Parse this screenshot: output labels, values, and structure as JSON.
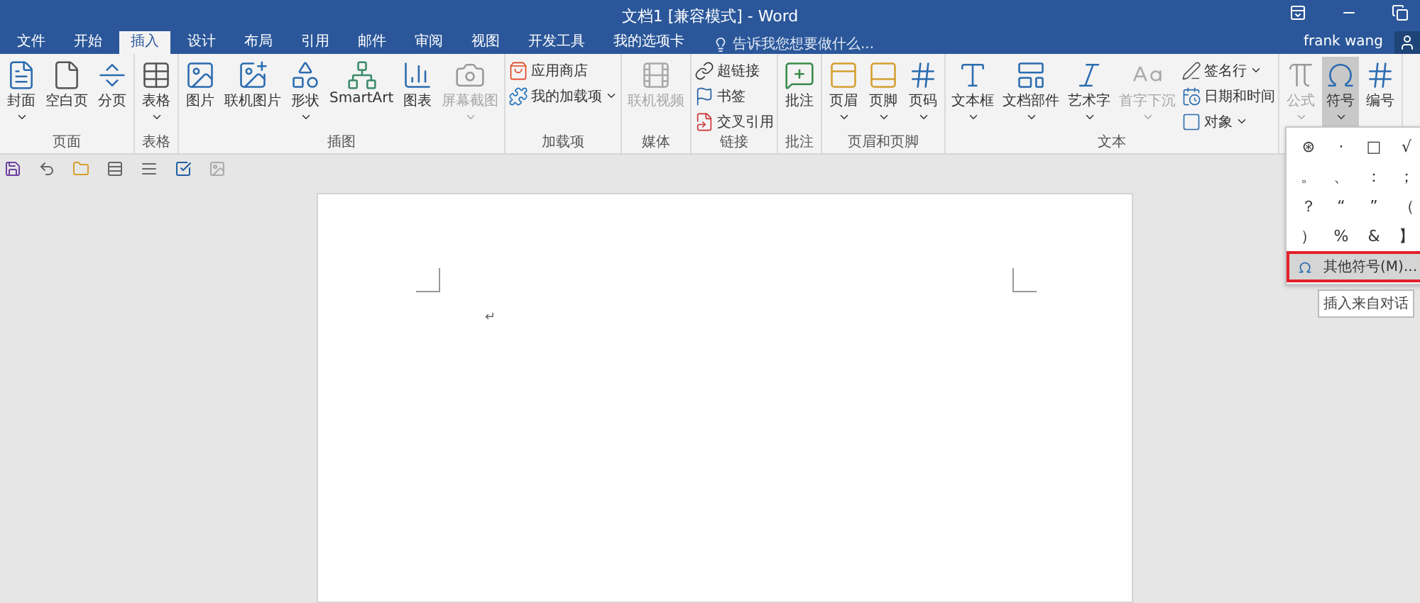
{
  "window": {
    "title": "文档1 [兼容模式] - Word"
  },
  "tabs": [
    {
      "label": "文件",
      "selected": false
    },
    {
      "label": "开始",
      "selected": false
    },
    {
      "label": "插入",
      "selected": true
    },
    {
      "label": "设计",
      "selected": false
    },
    {
      "label": "布局",
      "selected": false
    },
    {
      "label": "引用",
      "selected": false
    },
    {
      "label": "邮件",
      "selected": false
    },
    {
      "label": "审阅",
      "selected": false
    },
    {
      "label": "视图",
      "selected": false
    },
    {
      "label": "开发工具",
      "selected": false
    },
    {
      "label": "我的选项卡",
      "selected": false
    }
  ],
  "tell_me": {
    "placeholder": "告诉我您想要做什么..."
  },
  "user": {
    "name": "frank wang"
  },
  "ribbon_groups": [
    {
      "label": "页面",
      "items": [
        {
          "kind": "large",
          "label": "封面",
          "dropdown": true,
          "disabled": false,
          "selected": false
        },
        {
          "kind": "large",
          "label": "空白页",
          "dropdown": false,
          "disabled": false,
          "selected": false
        },
        {
          "kind": "large",
          "label": "分页",
          "dropdown": false,
          "disabled": false,
          "selected": false
        }
      ]
    },
    {
      "label": "表格",
      "items": [
        {
          "kind": "large",
          "label": "表格",
          "dropdown": true,
          "disabled": false,
          "selected": false
        }
      ]
    },
    {
      "label": "插图",
      "items": [
        {
          "kind": "large",
          "label": "图片",
          "dropdown": false,
          "disabled": false,
          "selected": false
        },
        {
          "kind": "large",
          "label": "联机图片",
          "dropdown": false,
          "disabled": false,
          "selected": false
        },
        {
          "kind": "large",
          "label": "形状",
          "dropdown": true,
          "disabled": false,
          "selected": false
        },
        {
          "kind": "large",
          "label": "SmartArt",
          "dropdown": false,
          "disabled": false,
          "selected": false
        },
        {
          "kind": "large",
          "label": "图表",
          "dropdown": false,
          "disabled": false,
          "selected": false
        },
        {
          "kind": "large",
          "label": "屏幕截图",
          "dropdown": true,
          "disabled": true,
          "selected": false
        }
      ]
    },
    {
      "label": "加载项",
      "items": [
        {
          "kind": "small",
          "label": "应用商店",
          "dropdown": false,
          "disabled": false,
          "selected": false
        },
        {
          "kind": "small",
          "label": "我的加载项",
          "dropdown": true,
          "disabled": false,
          "selected": false
        }
      ]
    },
    {
      "label": "媒体",
      "items": [
        {
          "kind": "large",
          "label": "联机视频",
          "dropdown": false,
          "disabled": true,
          "selected": false
        }
      ]
    },
    {
      "label": "链接",
      "items": [
        {
          "kind": "small",
          "label": "超链接",
          "dropdown": false,
          "disabled": false,
          "selected": false
        },
        {
          "kind": "small",
          "label": "书签",
          "dropdown": false,
          "disabled": false,
          "selected": false
        },
        {
          "kind": "small",
          "label": "交叉引用",
          "dropdown": false,
          "disabled": false,
          "selected": false
        }
      ]
    },
    {
      "label": "批注",
      "items": [
        {
          "kind": "large",
          "label": "批注",
          "dropdown": false,
          "disabled": false,
          "selected": false
        }
      ]
    },
    {
      "label": "页眉和页脚",
      "items": [
        {
          "kind": "large",
          "label": "页眉",
          "dropdown": true,
          "disabled": false,
          "selected": false
        },
        {
          "kind": "large",
          "label": "页脚",
          "dropdown": true,
          "disabled": false,
          "selected": false
        },
        {
          "kind": "large",
          "label": "页码",
          "dropdown": true,
          "disabled": false,
          "selected": false
        }
      ]
    },
    {
      "label": "文本",
      "items": [
        {
          "kind": "large",
          "label": "文本框",
          "dropdown": true,
          "disabled": false,
          "selected": false
        },
        {
          "kind": "large",
          "label": "文档部件",
          "dropdown": true,
          "disabled": false,
          "selected": false
        },
        {
          "kind": "large",
          "label": "艺术字",
          "dropdown": true,
          "disabled": false,
          "selected": false
        },
        {
          "kind": "large",
          "label": "首字下沉",
          "dropdown": true,
          "disabled": true,
          "selected": false
        },
        {
          "kind": "small",
          "label": "签名行",
          "dropdown": true,
          "disabled": false,
          "selected": false
        },
        {
          "kind": "small",
          "label": "日期和时间",
          "dropdown": false,
          "disabled": false,
          "selected": false
        },
        {
          "kind": "small",
          "label": "对象",
          "dropdown": true,
          "disabled": false,
          "selected": false
        }
      ]
    },
    {
      "items": [
        {
          "kind": "large",
          "label": "公式",
          "dropdown": true,
          "disabled": true,
          "selected": false
        },
        {
          "kind": "large",
          "label": "符号",
          "dropdown": true,
          "disabled": false,
          "selected": true
        },
        {
          "kind": "large",
          "label": "编号",
          "dropdown": false,
          "disabled": false,
          "selected": false
        }
      ]
    }
  ],
  "document": {
    "paragraph_mark": "↵"
  },
  "symbol_menu": {
    "symbols": [
      "⊛",
      "·",
      "□",
      "√",
      "。",
      "、",
      "：",
      "；",
      "？",
      "“",
      "”",
      "（",
      "）",
      "%",
      "&",
      "】"
    ],
    "more": {
      "label": "其他符号(M)...",
      "outlined": true
    },
    "tooltip": "插入来自对话"
  }
}
